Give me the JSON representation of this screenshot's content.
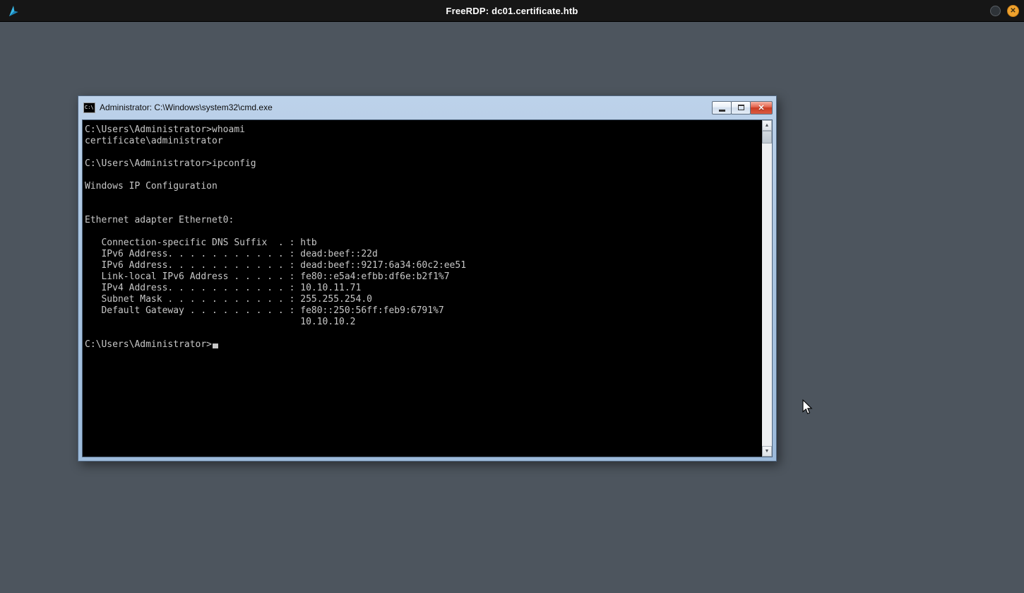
{
  "rdp": {
    "title": "FreeRDP: dc01.certificate.htb"
  },
  "icons": {
    "rdp_close": "✕",
    "cmd_close": "✕",
    "scroll_up": "▲",
    "scroll_down": "▼",
    "cmd_icon_text": "C:\\"
  },
  "cmd_window": {
    "title": "Administrator: C:\\Windows\\system32\\cmd.exe",
    "terminal_lines": [
      "C:\\Users\\Administrator>whoami",
      "certificate\\administrator",
      "",
      "C:\\Users\\Administrator>ipconfig",
      "",
      "Windows IP Configuration",
      "",
      "",
      "Ethernet adapter Ethernet0:",
      "",
      "   Connection-specific DNS Suffix  . : htb",
      "   IPv6 Address. . . . . . . . . . . : dead:beef::22d",
      "   IPv6 Address. . . . . . . . . . . : dead:beef::9217:6a34:60c2:ee51",
      "   Link-local IPv6 Address . . . . . : fe80::e5a4:efbb:df6e:b2f1%7",
      "   IPv4 Address. . . . . . . . . . . : 10.10.11.71",
      "   Subnet Mask . . . . . . . . . . . : 255.255.254.0",
      "   Default Gateway . . . . . . . . . : fe80::250:56ff:feb9:6791%7",
      "                                       10.10.10.2",
      "",
      "C:\\Users\\Administrator>"
    ]
  },
  "colors": {
    "desktop_background": "#4d555e",
    "rdp_titlebar": "#161616",
    "cmd_titlebar": "#a9c4e0",
    "terminal_background": "#000000",
    "terminal_text": "#c7c7c7",
    "rdp_close_button": "#f0a22e",
    "cmd_close_button": "#d04a32"
  }
}
